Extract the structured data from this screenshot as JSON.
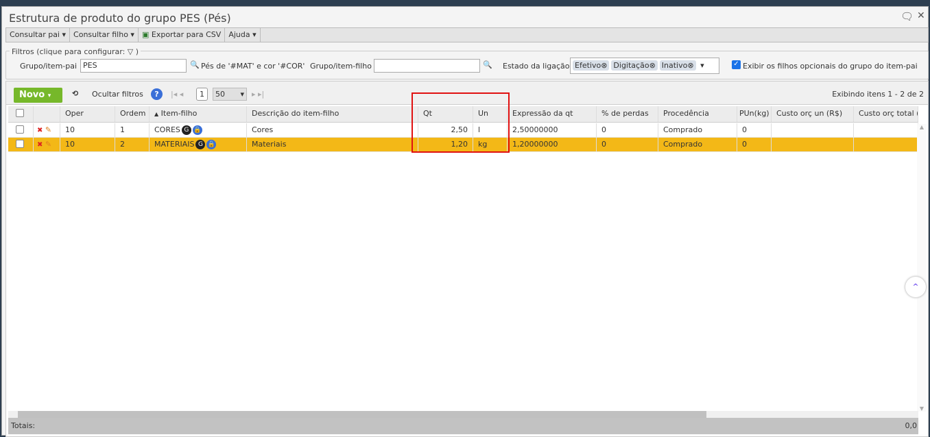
{
  "window": {
    "title": "Estrutura de produto do grupo PES (Pés)"
  },
  "menu": [
    "Consultar pai",
    "Consultar filho",
    "Exportar para CSV",
    "Ajuda"
  ],
  "filters": {
    "legend": "Filtros (clique para configurar:",
    "legend_end": ")",
    "parent_label": "Grupo/item-pai",
    "parent_value": "PES",
    "parent_desc": "Pés de '#MAT' e cor '#COR'",
    "child_label": "Grupo/item-filho",
    "child_value": "",
    "state_label": "Estado da ligação",
    "states": [
      "Efetivo",
      "Digitação",
      "Inativo"
    ],
    "optional_label": "Exibir os filhos opcionais do grupo do item-pai",
    "optional_checked": true
  },
  "toolbar": {
    "new": "Novo",
    "hide_filters": "Ocultar filtros",
    "page": "1",
    "page_size": "50",
    "status": "Exibindo itens 1 - 2 de 2"
  },
  "columns": [
    "Oper",
    "Ordem",
    "Item-filho",
    "Descrição do item-filho",
    "Qt",
    "Un",
    "Expressão da qt",
    "% de perdas",
    "Procedência",
    "PUn(kg)",
    "Custo orç un (R$)",
    "Custo orç total ("
  ],
  "rows": [
    {
      "oper": "10",
      "ordem": "1",
      "item": "CORES",
      "desc": "Cores",
      "qt": "2,50",
      "un": "l",
      "expr": "2,50000000",
      "perdas": "0",
      "proc": "Comprado",
      "pun": "0",
      "cun": "",
      "ctot": "",
      "selected": false
    },
    {
      "oper": "10",
      "ordem": "2",
      "item": "MATERIAIS",
      "desc": "Materiais",
      "qt": "1,20",
      "un": "kg",
      "expr": "1,20000000",
      "perdas": "0",
      "proc": "Comprado",
      "pun": "0",
      "cun": "",
      "ctot": "",
      "selected": true
    }
  ],
  "totals": {
    "label": "Totais:",
    "value": "0,0"
  },
  "colors": {
    "selected_row": "#f3b817",
    "new_button": "#76b82a",
    "highlight": "#e01010"
  }
}
